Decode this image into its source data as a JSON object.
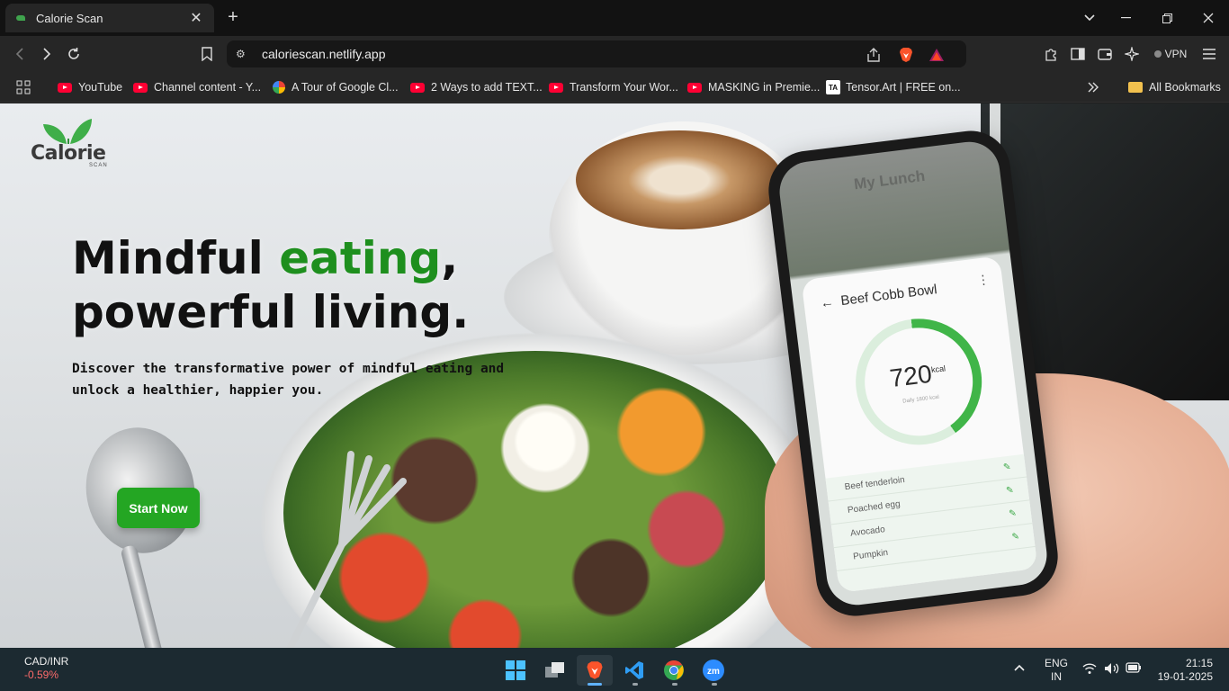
{
  "browser": {
    "tab_title": "Calorie Scan",
    "url": "caloriescan.netlify.app",
    "vpn_label": "VPN",
    "bookmarks": [
      {
        "label": "YouTube",
        "icon": "youtube-icon"
      },
      {
        "label": "Channel content - Y...",
        "icon": "youtube-icon"
      },
      {
        "label": "A Tour of Google Cl...",
        "icon": "google-cloud-icon"
      },
      {
        "label": "2 Ways to add TEXT...",
        "icon": "youtube-icon"
      },
      {
        "label": "Transform Your Wor...",
        "icon": "youtube-icon"
      },
      {
        "label": "MASKING in Premie...",
        "icon": "youtube-icon"
      },
      {
        "label": "Tensor.Art | FREE on...",
        "icon": "tensor-art-icon"
      }
    ],
    "tensor_badge": "TA",
    "all_bookmarks": "All Bookmarks"
  },
  "page": {
    "logo_text": "Calorie",
    "logo_sub": "SCAN",
    "hero_line1_pre": "Mindful ",
    "hero_line1_accent": "eating",
    "hero_line1_post": ",",
    "hero_line2": "powerful living.",
    "subtitle": "Discover the transformative power of mindful eating and unlock a healthier, happier you.",
    "cta_label": "Start Now",
    "accent_color": "#1e8f1e",
    "cta_color": "#24a623"
  },
  "phone": {
    "header": "My Lunch",
    "title": "Beef Cobb Bowl",
    "kcal": "720",
    "kcal_unit": "kcal",
    "daily": "Daily 1800 kcal",
    "items": [
      "Beef tenderloin",
      "Poached egg",
      "Avocado",
      "Pumpkin"
    ]
  },
  "taskbar": {
    "ticker_pair": "CAD/INR",
    "ticker_change": "-0.59%",
    "lang": "ENG",
    "region": "IN",
    "time": "21:15",
    "date": "19-01-2025",
    "zoom_label": "zm"
  }
}
